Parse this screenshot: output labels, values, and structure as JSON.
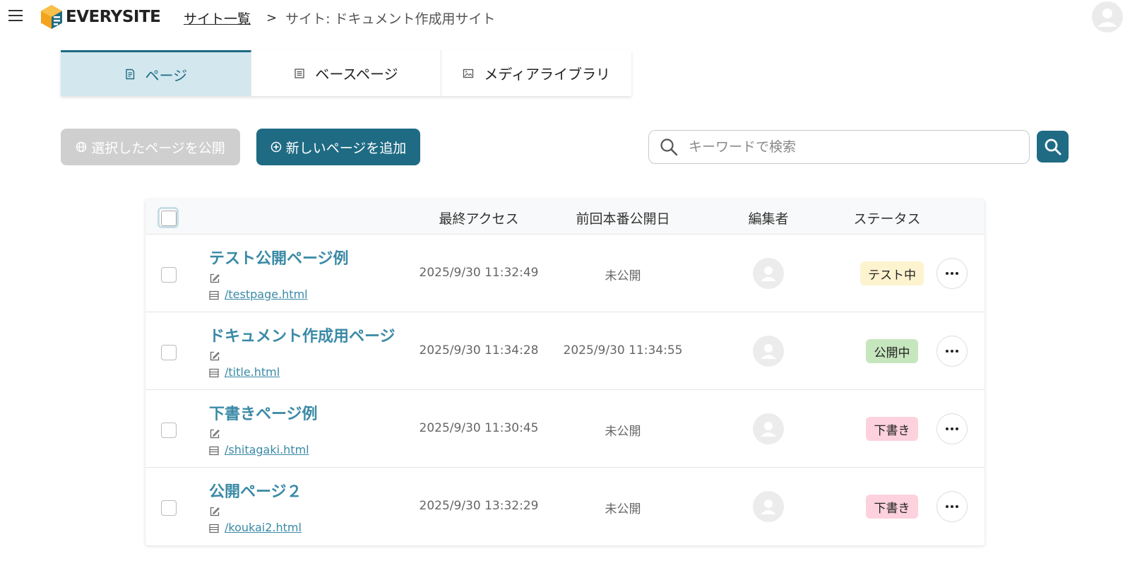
{
  "header": {
    "menu_icon": "hamburger-menu-icon",
    "logo_text": "EVERYSITE",
    "breadcrumb": {
      "link": "サイト一覧",
      "separator": ">",
      "current": "サイト: ドキュメント作成用サイト"
    },
    "user_avatar_icon": "user-avatar-icon"
  },
  "tabs": [
    {
      "label": "ページ",
      "icon": "page-icon",
      "active": true
    },
    {
      "label": "ベースページ",
      "icon": "base-page-icon",
      "active": false
    },
    {
      "label": "メディアライブラリ",
      "icon": "image-icon",
      "active": false
    }
  ],
  "toolbar": {
    "publish_label": "選択したページを公開",
    "add_label": "新しいページを追加",
    "search_placeholder": "キーワードで検索",
    "search_value": ""
  },
  "table": {
    "columns": [
      "最終アクセス",
      "前回本番公開日",
      "編集者",
      "ステータス"
    ],
    "rows": [
      {
        "title": "テスト公開ページ例",
        "path": "/testpage.html",
        "last_access": "2025/9/30 11:32:49",
        "last_published": "未公開",
        "status": "テスト中",
        "status_color": "#fdf3cf"
      },
      {
        "title": "ドキュメント作成用ページ",
        "path": "/title.html",
        "last_access": "2025/9/30 11:34:28",
        "last_published": "2025/9/30 11:34:55",
        "status": "公開中",
        "status_color": "#c6e6bd"
      },
      {
        "title": "下書きページ例",
        "path": "/shitagaki.html",
        "last_access": "2025/9/30 11:30:45",
        "last_published": "未公開",
        "status": "下書き",
        "status_color": "#fdd1dd"
      },
      {
        "title": "公開ページ２",
        "path": "/koukai2.html",
        "last_access": "2025/9/30 13:32:29",
        "last_published": "未公開",
        "status": "下書き",
        "status_color": "#fdd1dd"
      }
    ]
  },
  "colors": {
    "primary": "#1f6b84",
    "link": "#3a8aa6",
    "tab_active_bg": "#d3e7ee",
    "disabled_button": "#cfcfcf"
  }
}
